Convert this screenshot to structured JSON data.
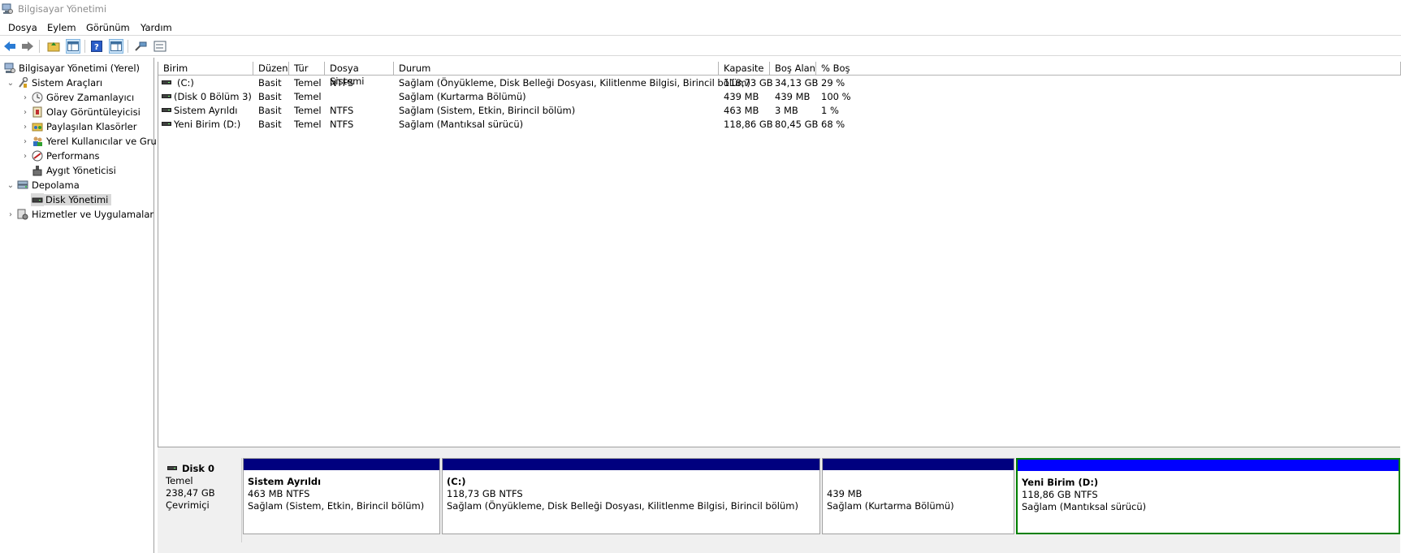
{
  "window": {
    "title": "Bilgisayar Yönetimi"
  },
  "menu": [
    "Dosya",
    "Eylem",
    "Görünüm",
    "Yardım"
  ],
  "toolbar": {
    "icons": [
      "back-arrow-icon",
      "forward-arrow-icon",
      "up-folder-icon",
      "show-hide-tree-icon",
      "help-icon",
      "console-pane-icon",
      "connect-icon",
      "properties-icon"
    ]
  },
  "tree": {
    "root": "Bilgisayar Yönetimi (Yerel)",
    "items": [
      {
        "label": "Sistem Araçları",
        "icon": "tools-icon"
      },
      {
        "label": "Görev Zamanlayıcı",
        "icon": "clock-icon"
      },
      {
        "label": "Olay Görüntüleyicisi",
        "icon": "event-viewer-icon"
      },
      {
        "label": "Paylaşılan Klasörler",
        "icon": "shared-folder-icon"
      },
      {
        "label": "Yerel Kullanıcılar ve Gru",
        "icon": "users-icon"
      },
      {
        "label": "Performans",
        "icon": "performance-icon"
      },
      {
        "label": "Aygıt Yöneticisi",
        "icon": "device-manager-icon"
      },
      {
        "label": "Depolama",
        "icon": "storage-icon"
      },
      {
        "label": "Disk Yönetimi",
        "icon": "disk-icon"
      },
      {
        "label": "Hizmetler ve Uygulamalar",
        "icon": "services-icon"
      }
    ]
  },
  "volumes": {
    "columns": [
      "Birim",
      "Düzen",
      "Tür",
      "Dosya Sistemi",
      "Durum",
      "Kapasite",
      "Boş Alan",
      "% Boş"
    ],
    "rows": [
      {
        "name": "(C:)",
        "layout": "Basit",
        "type": "Temel",
        "fs": "NTFS",
        "status": "Sağlam (Önyükleme, Disk Belleği Dosyası, Kilitlenme Bilgisi, Birincil bölüm)",
        "capacity": "118,73 GB",
        "free": "34,13 GB",
        "pct": "29 %"
      },
      {
        "name": "(Disk 0 Bölüm 3)",
        "layout": "Basit",
        "type": "Temel",
        "fs": "",
        "status": "Sağlam (Kurtarma Bölümü)",
        "capacity": "439 MB",
        "free": "439 MB",
        "pct": "100 %"
      },
      {
        "name": "Sistem Ayrıldı",
        "layout": "Basit",
        "type": "Temel",
        "fs": "NTFS",
        "status": "Sağlam (Sistem, Etkin, Birincil bölüm)",
        "capacity": "463 MB",
        "free": "3 MB",
        "pct": "1 %"
      },
      {
        "name": "Yeni Birim (D:)",
        "layout": "Basit",
        "type": "Temel",
        "fs": "NTFS",
        "status": "Sağlam (Mantıksal sürücü)",
        "capacity": "118,86 GB",
        "free": "80,45 GB",
        "pct": "68 %"
      }
    ]
  },
  "disk": {
    "name": "Disk 0",
    "type": "Temel",
    "size": "238,47 GB",
    "state": "Çevrimiçi",
    "partitions": [
      {
        "title": "Sistem Ayrıldı",
        "size": "463 MB NTFS",
        "status": "Sağlam (Sistem, Etkin, Birincil bölüm)"
      },
      {
        "title": "(C:)",
        "size": "118,73 GB NTFS",
        "status": "Sağlam (Önyükleme, Disk Belleği Dosyası, Kilitlenme Bilgisi, Birincil bölüm)"
      },
      {
        "title": "",
        "size": "439 MB",
        "status": "Sağlam (Kurtarma Bölümü)"
      },
      {
        "title": "Yeni Birim  (D:)",
        "size": "118,86 GB NTFS",
        "status": "Sağlam (Mantıksal sürücü)"
      }
    ]
  },
  "colors": {
    "primary_partition": "#00007f",
    "logical_drive": "#0000ff",
    "selection": "#008000"
  }
}
